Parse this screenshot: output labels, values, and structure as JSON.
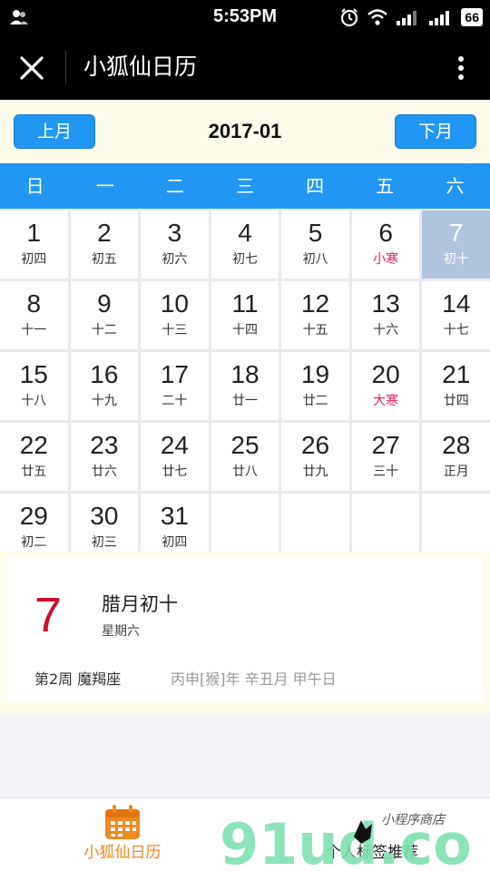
{
  "status_bar": {
    "time": "5:53PM",
    "battery": "66"
  },
  "nav": {
    "title": "小狐仙日历"
  },
  "month_nav": {
    "prev_label": "上月",
    "month": "2017-01",
    "next_label": "下月"
  },
  "weekdays": [
    "日",
    "一",
    "二",
    "三",
    "四",
    "五",
    "六"
  ],
  "days": [
    {
      "num": "1",
      "lunar": "初四"
    },
    {
      "num": "2",
      "lunar": "初五"
    },
    {
      "num": "3",
      "lunar": "初六"
    },
    {
      "num": "4",
      "lunar": "初七"
    },
    {
      "num": "5",
      "lunar": "初八"
    },
    {
      "num": "6",
      "lunar": "小寒",
      "term": true
    },
    {
      "num": "7",
      "lunar": "初十",
      "selected": true
    },
    {
      "num": "8",
      "lunar": "十一"
    },
    {
      "num": "9",
      "lunar": "十二"
    },
    {
      "num": "10",
      "lunar": "十三"
    },
    {
      "num": "11",
      "lunar": "十四"
    },
    {
      "num": "12",
      "lunar": "十五"
    },
    {
      "num": "13",
      "lunar": "十六"
    },
    {
      "num": "14",
      "lunar": "十七"
    },
    {
      "num": "15",
      "lunar": "十八"
    },
    {
      "num": "16",
      "lunar": "十九"
    },
    {
      "num": "17",
      "lunar": "二十"
    },
    {
      "num": "18",
      "lunar": "廿一"
    },
    {
      "num": "19",
      "lunar": "廿二"
    },
    {
      "num": "20",
      "lunar": "大寒",
      "term": true
    },
    {
      "num": "21",
      "lunar": "廿四"
    },
    {
      "num": "22",
      "lunar": "廿五"
    },
    {
      "num": "23",
      "lunar": "廿六"
    },
    {
      "num": "24",
      "lunar": "廿七"
    },
    {
      "num": "25",
      "lunar": "廿八"
    },
    {
      "num": "26",
      "lunar": "廿九"
    },
    {
      "num": "27",
      "lunar": "三十"
    },
    {
      "num": "28",
      "lunar": "正月"
    },
    {
      "num": "29",
      "lunar": "初二"
    },
    {
      "num": "30",
      "lunar": "初三"
    },
    {
      "num": "31",
      "lunar": "初四"
    }
  ],
  "detail": {
    "day": "7",
    "lunar_date": "腊月初十",
    "weekday": "星期六",
    "week_zodiac": "第2周 魔羯座",
    "ganzhi": "丙申[猴]年 辛丑月 甲午日"
  },
  "tabs": [
    {
      "label": "小狐仙日历",
      "active": true
    },
    {
      "label": "个人标签推荐",
      "active": false
    }
  ],
  "colors": {
    "accent": "#2196f3",
    "selected_cell": "#b0c4de",
    "solar_term": "#e0245e",
    "detail_day": "#c8102e",
    "tab_active": "#f08a24"
  },
  "watermark": {
    "brand": "91ud.com",
    "tagline": "小程序商店"
  }
}
